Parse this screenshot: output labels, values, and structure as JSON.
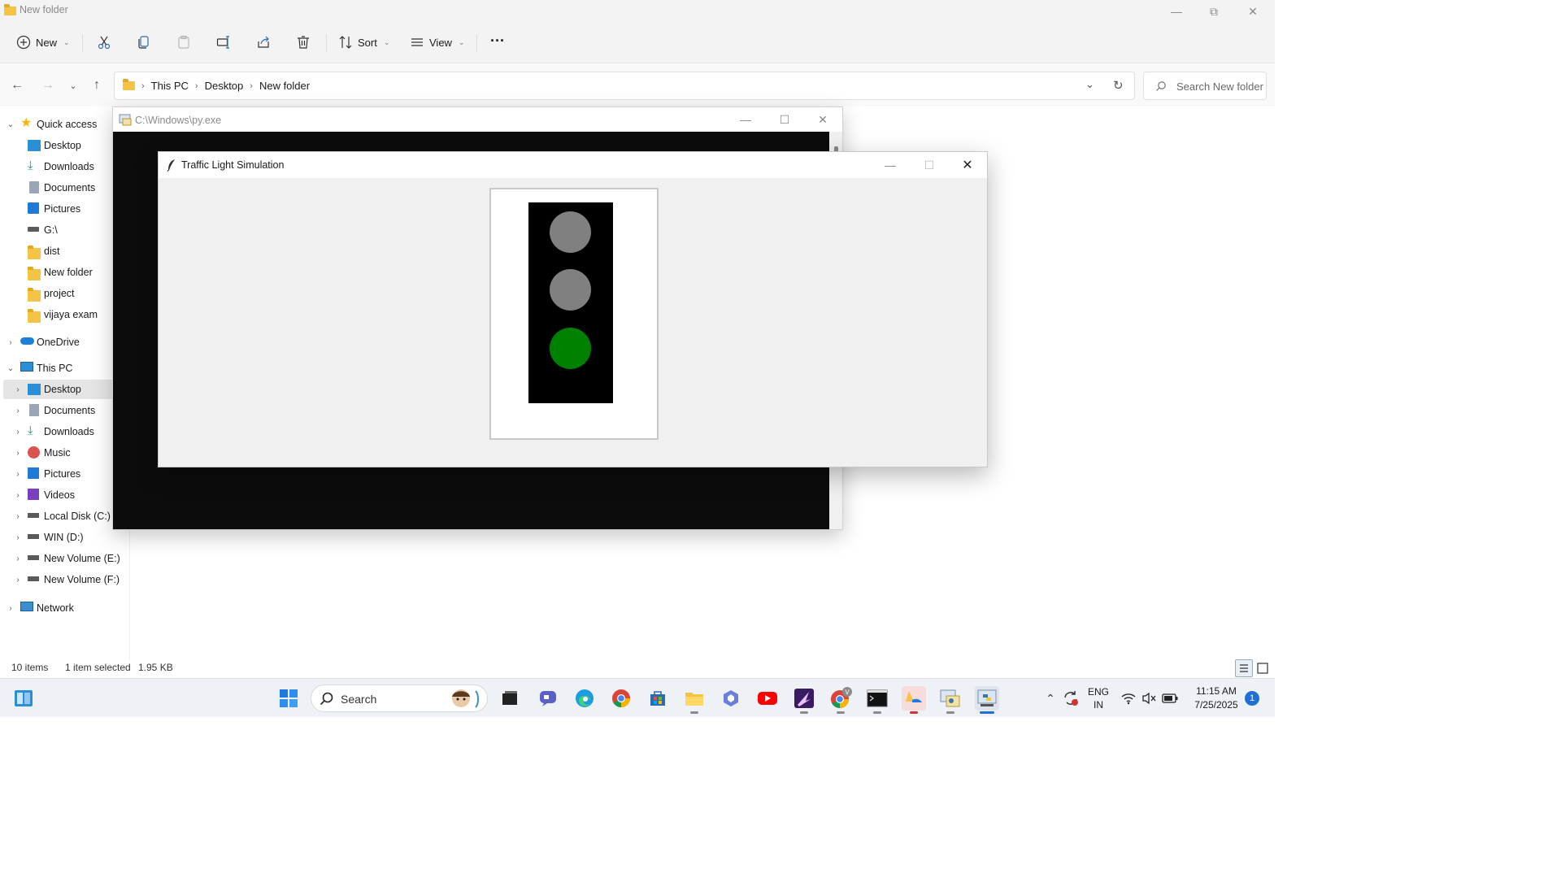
{
  "explorer": {
    "title": "New folder",
    "toolbar": {
      "new_label": "New",
      "sort_label": "Sort",
      "view_label": "View",
      "more_label": "···"
    },
    "breadcrumb": [
      "This PC",
      "Desktop",
      "New folder"
    ],
    "search_placeholder": "Search New folder",
    "sidebar": {
      "quick_access": "Quick access",
      "quick_items": [
        "Desktop",
        "Downloads",
        "Documents",
        "Pictures",
        "G:\\",
        "dist",
        "New folder",
        "project",
        "vijaya exam"
      ],
      "onedrive": "OneDrive",
      "this_pc": "This PC",
      "pc_items": [
        "Desktop",
        "Documents",
        "Downloads",
        "Music",
        "Pictures",
        "Videos",
        "Local Disk (C:)",
        "WIN (D:)",
        "New Volume (E:)",
        "New Volume (F:)"
      ],
      "network": "Network"
    },
    "status": {
      "items": "10 items",
      "selected": "1 item selected",
      "size": "1.95 KB"
    }
  },
  "console": {
    "title": "C:\\Windows\\py.exe"
  },
  "tk_window": {
    "title": "Traffic Light Simulation",
    "lights": [
      {
        "name": "red",
        "color": "#808080",
        "state": "off"
      },
      {
        "name": "yellow",
        "color": "#808080",
        "state": "off"
      },
      {
        "name": "green",
        "color": "#008000",
        "state": "on"
      }
    ]
  },
  "taskbar": {
    "search_label": "Search",
    "lang_top": "ENG",
    "lang_bottom": "IN",
    "time": "11:15 AM",
    "date": "7/25/2025",
    "notification_count": "1"
  }
}
